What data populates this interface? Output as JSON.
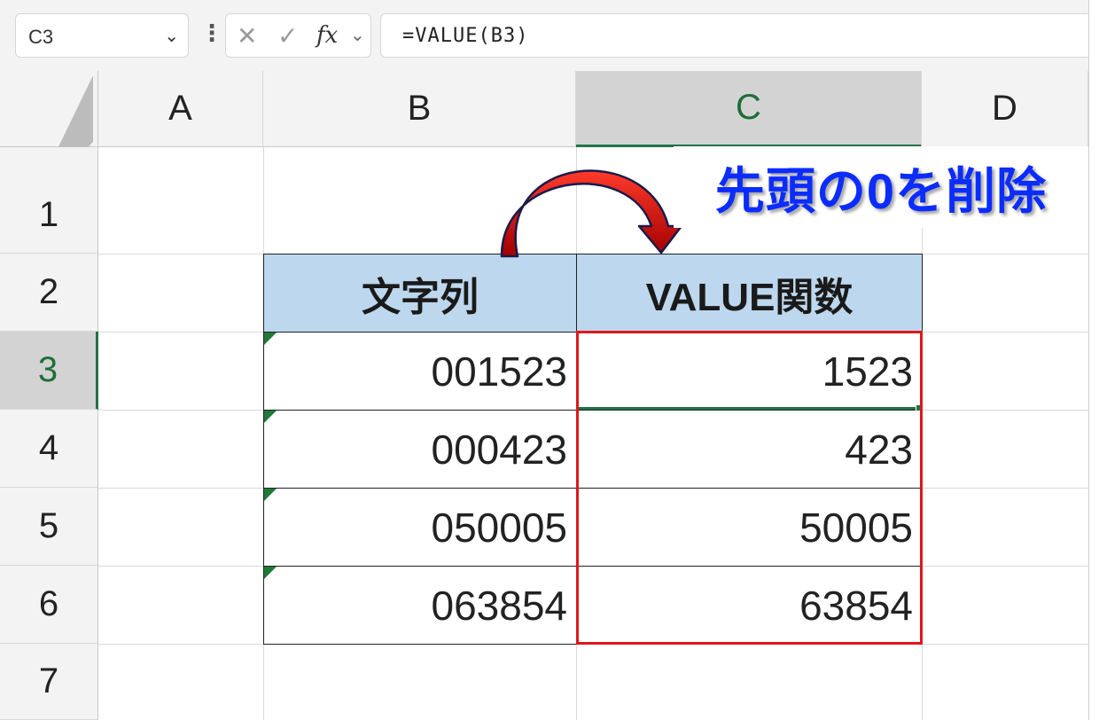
{
  "formula_bar": {
    "name_box": "C3",
    "name_box_dropdown_icon": "chevron-down-icon",
    "more_icon": "vertical-ellipsis-icon",
    "cancel_icon": "close-icon",
    "enter_icon": "checkmark-icon",
    "function_icon": "fx-icon",
    "formula": "=VALUE(B3)"
  },
  "columns": [
    "A",
    "B",
    "C",
    "D"
  ],
  "rows": [
    "1",
    "2",
    "3",
    "4",
    "5",
    "6",
    "7"
  ],
  "table": {
    "headers": [
      "文字列",
      "VALUE関数"
    ],
    "rows": [
      [
        "001523",
        "1523"
      ],
      [
        "000423",
        "423"
      ],
      [
        "050005",
        "50005"
      ],
      [
        "063854",
        "63854"
      ]
    ],
    "header_color": "#bdd7ee"
  },
  "annotation": {
    "callout": "先頭の0を削除",
    "callout_color": "#0b2cff",
    "highlight_color": "#e0161b",
    "arrow_color": "#d01010"
  },
  "selection": {
    "active_column": "C",
    "active_row": "3",
    "accent": "#217346"
  }
}
